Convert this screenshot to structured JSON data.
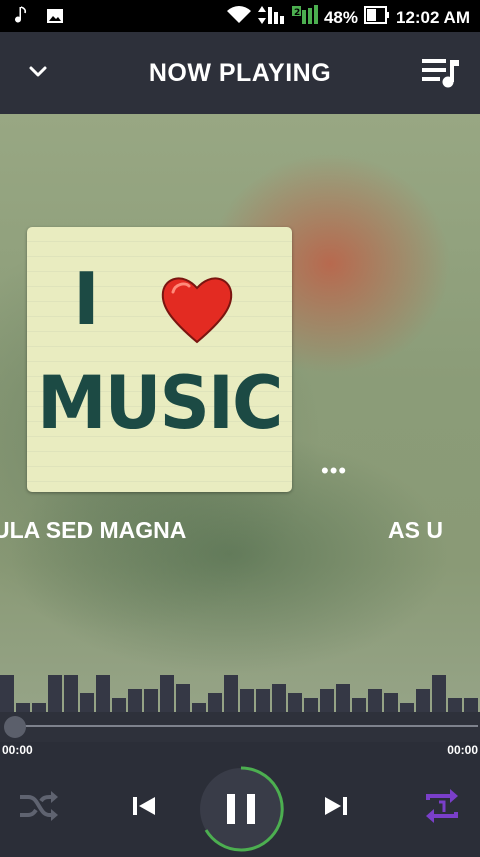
{
  "status_bar": {
    "battery_percent": "48%",
    "time": "12:02 AM",
    "sim_label": "2",
    "icons": [
      "music-note-icon",
      "image-icon",
      "wifi-icon",
      "data-arrows-icon",
      "signal-icon",
      "battery-icon"
    ]
  },
  "header": {
    "title": "NOW PLAYING",
    "collapse_icon": "chevron-down-icon",
    "queue_icon": "playlist-icon"
  },
  "album_art": {
    "text_line1": "I",
    "text_line2": "MUSIC",
    "more_label": "•••"
  },
  "carousel": {
    "current_title_fragment": "ULA SED MAGNA",
    "next_title_fragment": "AS U"
  },
  "progress": {
    "elapsed": "00:00",
    "total": "00:00",
    "fraction": 0
  },
  "visualizer": {
    "levels": [
      0.72,
      0.18,
      0.18,
      0.72,
      0.72,
      0.36,
      0.72,
      0.27,
      0.45,
      0.45,
      0.72,
      0.54,
      0.18,
      0.36,
      0.72,
      0.45,
      0.45,
      0.54,
      0.36,
      0.27,
      0.45,
      0.54,
      0.27,
      0.45,
      0.36,
      0.18,
      0.45,
      0.72,
      0.27,
      0.27
    ]
  },
  "controls": {
    "shuffle_icon": "shuffle-icon",
    "previous_icon": "skip-previous-icon",
    "play_pause_icon": "pause-icon",
    "next_icon": "skip-next-icon",
    "repeat_icon": "repeat-one-icon",
    "accent_color": "#7a3fc9",
    "progress_ring_color": "#4caf50"
  }
}
